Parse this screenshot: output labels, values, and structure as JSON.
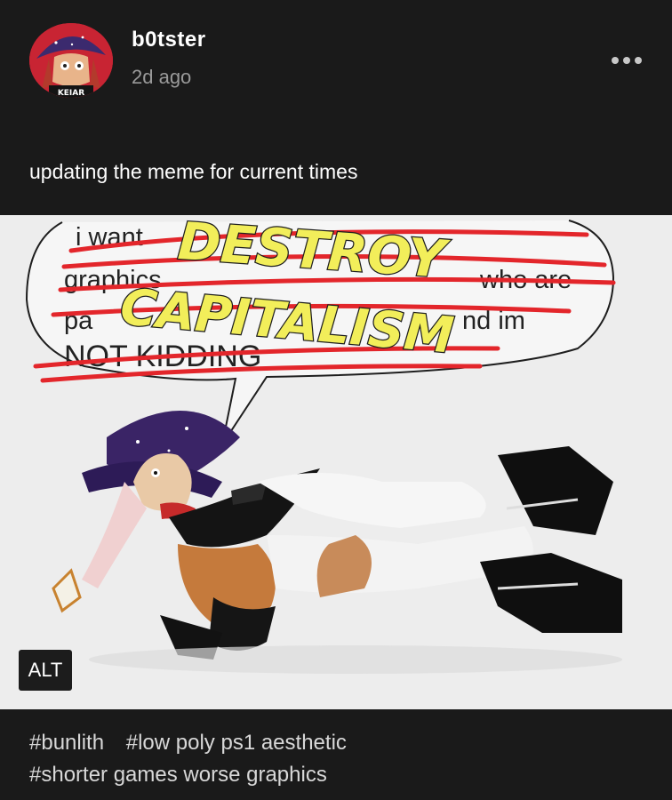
{
  "post": {
    "username": "b0tster",
    "timestamp": "2d ago",
    "caption": "updating the meme for current times"
  },
  "image": {
    "alt_button_label": "ALT",
    "speech_bubble_lines": [
      "i want",
      "graphics",
      "who are",
      "pa",
      "nd im",
      "NOT KIDDING"
    ],
    "overlay_line_1": "DESTROY",
    "overlay_line_2": "CAPITALISM",
    "avatar_badge_text": "KEIAR"
  },
  "tags": {
    "row1": [
      "#bunlith",
      "#low poly ps1 aesthetic"
    ],
    "row2": [
      "#shorter games worse graphics"
    ]
  },
  "colors": {
    "background": "#1a1a1a",
    "overlay_yellow": "#f2ee5a",
    "scribble_red": "#e3262b",
    "avatar_red": "#c82433"
  }
}
